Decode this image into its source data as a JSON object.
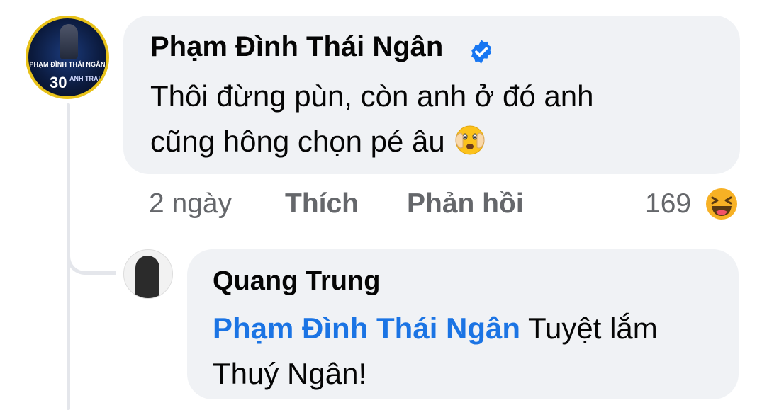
{
  "thread": {
    "comment": {
      "author": "Phạm Đình Thái Ngân",
      "verified": true,
      "text_line1": "Thôi đừng pùn, còn anh ở đó anh",
      "text_line2": "cũng hông chọn pé âu",
      "emoji": "face-with-open-eyes-and-hand-over-mouth",
      "avatar_text": {
        "name": "PHẠM ĐÌNH THÁI NGÂN",
        "big": "30",
        "side": "ANH TRAI"
      },
      "actions": {
        "time": "2 ngày",
        "like": "Thích",
        "reply": "Phản hồi"
      },
      "reaction_count": "169",
      "reaction_icon": "haha-icon"
    },
    "reply": {
      "author": "Quang Trung",
      "mention": "Phạm Đình Thái Ngân",
      "text_after_mention": " Tuyệt lắm",
      "text_line2": "Thuý Ngân!"
    }
  },
  "colors": {
    "bubble_bg": "#f0f2f5",
    "mention": "#1b74e4",
    "meta_text": "#65676b",
    "verified": "#1877f2",
    "reaction_yellow": "#f7b125"
  }
}
